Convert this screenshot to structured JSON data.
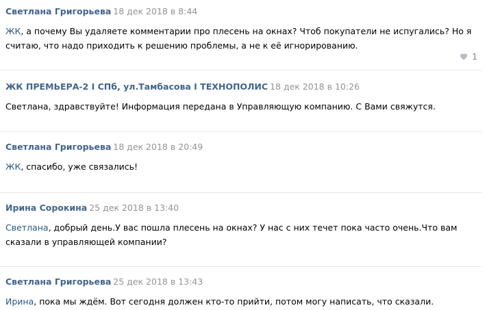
{
  "comments": [
    {
      "author": "Светлана Григорьева",
      "date": "18 дек 2018 в 8:44",
      "reply_to": "ЖК",
      "text": ", а почему Вы удаляете комментарии про плесень на окнах? Чтоб покупатели не испугались? Но я считаю, что надо приходить к решению проблемы, а не к её игнорированию.",
      "likes": "1"
    },
    {
      "author": "ЖК ПРЕМЬЕРА-2 I СПб, ул.Тамбасова I ТЕХНОПОЛИС",
      "date": "18 дек 2018 в 10:26",
      "reply_to": "",
      "text": "Светлана, здравствуйте! Информация передана в Управляющую компанию. С Вами свяжутся."
    },
    {
      "author": "Светлана Григорьева",
      "date": "18 дек 2018 в 20:49",
      "reply_to": "ЖК",
      "text": ", спасибо, уже связались!"
    },
    {
      "author": "Ирина Сорокина",
      "date": "25 дек 2018 в 13:40",
      "reply_to": "Светлана",
      "text": ", добрый день.У вас пошла плесень на окнах? У нас с них течет пока часто очень.Что вам сказали в управляющей компании?"
    },
    {
      "author": "Светлана Григорьева",
      "date": "25 дек 2018 в 13:43",
      "reply_to": "Ирина",
      "text": ", пока мы ждём. Вот сегодня должен кто-то прийти, потом могу написать, что сказали."
    }
  ],
  "icons": {
    "like": "heart-icon"
  },
  "colors": {
    "author": "#42648b",
    "reply_link": "#2a5885",
    "date": "#939393",
    "divider": "#e7e8ec"
  }
}
